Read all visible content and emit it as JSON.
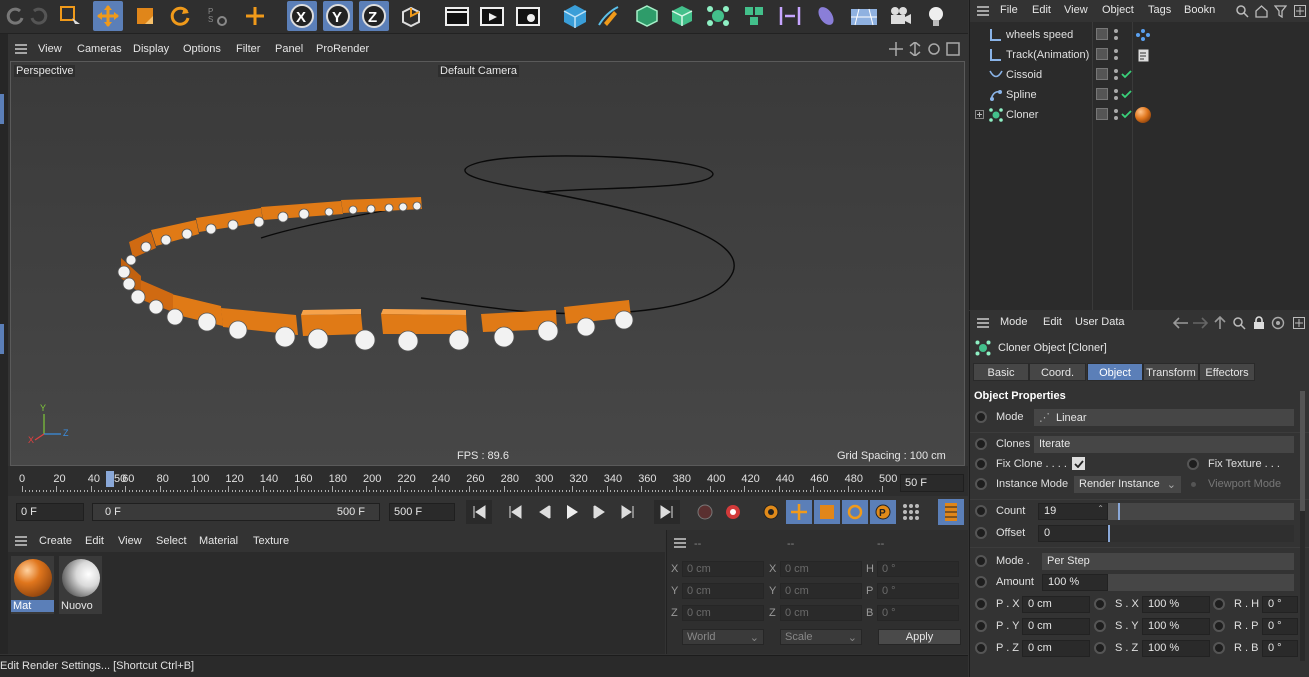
{
  "viewport": {
    "menu": [
      "View",
      "Cameras",
      "Display",
      "Options",
      "Filter",
      "Panel",
      "ProRender"
    ],
    "label_left": "Perspective",
    "camera": "Default Camera",
    "fps": "FPS : 89.6",
    "grid": "Grid Spacing : 100 cm",
    "axis_x": "X",
    "axis_y": "Y",
    "axis_z": "Z"
  },
  "timeline": {
    "ticks": [
      "0",
      "20",
      "40",
      "60",
      "80",
      "100",
      "120",
      "140",
      "160",
      "180",
      "200",
      "220",
      "240",
      "260",
      "280",
      "300",
      "320",
      "340",
      "360",
      "380",
      "400",
      "420",
      "440",
      "460",
      "480",
      "500"
    ],
    "current_marker": "50",
    "end_frame": "50 F"
  },
  "transport": {
    "start": "0 F",
    "range_left": "0 F",
    "range_right": "500 F",
    "end": "500 F"
  },
  "materials": {
    "menu": [
      "Create",
      "Edit",
      "View",
      "Select",
      "Material",
      "Texture"
    ],
    "items": [
      {
        "name": "Mat",
        "color": "#e0761d"
      },
      {
        "name": "Nuovo",
        "color": "#d9d9d9"
      }
    ]
  },
  "coords": {
    "headers": [
      "--",
      "--",
      "--"
    ],
    "rows": [
      {
        "a": "X",
        "av": "0 cm",
        "b": "X",
        "bv": "0 cm",
        "c": "H",
        "cv": "0 °"
      },
      {
        "a": "Y",
        "av": "0 cm",
        "b": "Y",
        "bv": "0 cm",
        "c": "P",
        "cv": "0 °"
      },
      {
        "a": "Z",
        "av": "0 cm",
        "b": "Z",
        "bv": "0 cm",
        "c": "B",
        "cv": "0 °"
      }
    ],
    "mode1": "World",
    "mode2": "Scale",
    "apply": "Apply"
  },
  "status": "Edit Render Settings... [Shortcut Ctrl+B]",
  "objects": {
    "menu": [
      "File",
      "Edit",
      "View",
      "Object",
      "Tags",
      "Bookn"
    ],
    "items": [
      {
        "name": "wheels speed"
      },
      {
        "name": "Track(Animation)"
      },
      {
        "name": "Cissoid"
      },
      {
        "name": "Spline"
      },
      {
        "name": "Cloner"
      }
    ]
  },
  "attributes": {
    "menu": [
      "Mode",
      "Edit",
      "User Data"
    ],
    "title": "Cloner Object [Cloner]",
    "tabs": [
      "Basic",
      "Coord.",
      "Object",
      "Transform",
      "Effectors"
    ],
    "section": "Object Properties",
    "mode_label": "Mode",
    "mode_value": "Linear",
    "clones_label": "Clones",
    "clones_value": "Iterate",
    "fixclone_label": "Fix Clone . . . .",
    "fixtexture_label": "Fix Texture . . .",
    "instance_label": "Instance Mode",
    "instance_value": "Render Instance",
    "viewport_mode": "Viewport Mode",
    "count_label": "Count",
    "count_value": "19",
    "count_fraction": 0.19,
    "offset_label": "Offset",
    "offset_value": "0",
    "mode2_label": "Mode .",
    "mode2_value": "Per Step",
    "amount_label": "Amount",
    "amount_value": "100 %",
    "px_label": "P . X",
    "px": "0 cm",
    "sx_label": "S . X",
    "sx": "100 %",
    "rh_label": "R . H",
    "rh": "0 °",
    "py_label": "P . Y",
    "py": "0 cm",
    "sy_label": "S . Y",
    "sy": "100 %",
    "rp_label": "R . P",
    "rp": "0 °",
    "pz_label": "P . Z",
    "pz": "0 cm",
    "sz_label": "S . Z",
    "sz": "100 %",
    "rb_label": "R . B",
    "rb": "0 °"
  }
}
